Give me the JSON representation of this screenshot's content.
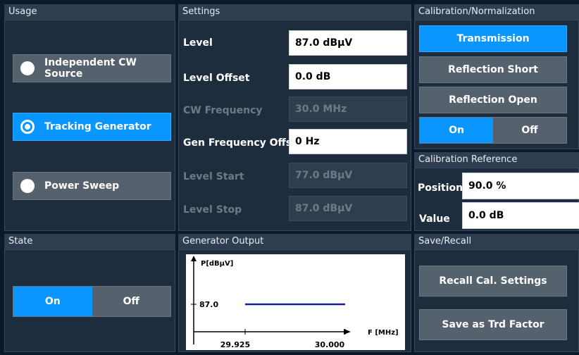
{
  "usage": {
    "title": "Usage",
    "options": [
      {
        "label": "Independent CW Source",
        "selected": false
      },
      {
        "label": "Tracking Generator",
        "selected": true
      },
      {
        "label": "Power Sweep",
        "selected": false
      }
    ]
  },
  "settings": {
    "title": "Settings",
    "rows": [
      {
        "label": "Level",
        "value": "87.0 dBµV",
        "enabled": true
      },
      {
        "label": "Level Offset",
        "value": "0.0 dB",
        "enabled": true
      },
      {
        "label": "CW Frequency",
        "value": "30.0 MHz",
        "enabled": false
      },
      {
        "label": "Gen Frequency Offs",
        "value": "0 Hz",
        "enabled": true
      },
      {
        "label": "Level Start",
        "value": "77.0 dBµV",
        "enabled": false
      },
      {
        "label": "Level Stop",
        "value": "87.0 dBµV",
        "enabled": false
      }
    ]
  },
  "calibration": {
    "title": "Calibration/Normalization",
    "buttons": [
      "Transmission",
      "Reflection Short",
      "Reflection Open"
    ],
    "active_button": "Transmission",
    "toggle_on": "On",
    "toggle_off": "Off",
    "toggle_state": "On"
  },
  "calibration_reference": {
    "title": "Calibration Reference",
    "position_label": "Position",
    "position_value": "90.0 %",
    "value_label": "Value",
    "value_value": "0.0 dB"
  },
  "state": {
    "title": "State",
    "on": "On",
    "off": "Off",
    "current": "On"
  },
  "generator_output": {
    "title": "Generator Output",
    "y_label": "P[dBµV]",
    "x_label": "F [MHz]",
    "level_label": "87.0",
    "x_start_label": "29.925",
    "x_stop_label": "30.000",
    "line_color": "#1a1aa6"
  },
  "save_recall": {
    "title": "Save/Recall",
    "recall_label": "Recall Cal. Settings",
    "save_label": "Save as Trd Factor"
  }
}
